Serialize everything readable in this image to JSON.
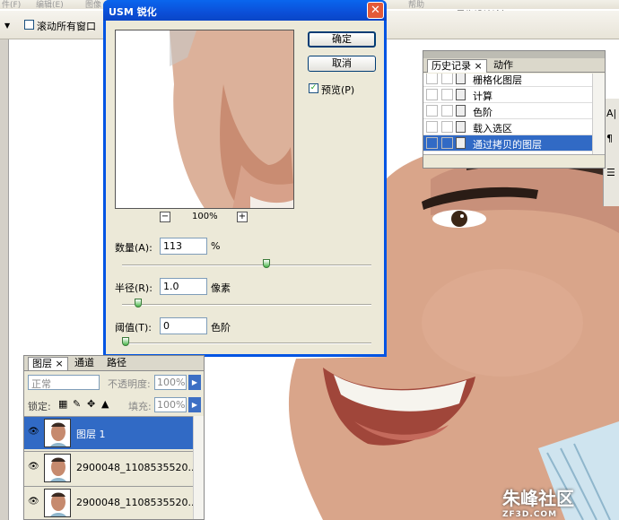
{
  "menubar": {
    "items": [
      "件(F)",
      "编辑(E)",
      "图像",
      "帮助"
    ]
  },
  "site_watermark": "思缘设计论坛 WWW.MISSYUAN.COM",
  "options": {
    "scroll_all_label": "滚动所有窗口"
  },
  "dialog": {
    "title": "USM 锐化",
    "close_glyph": "✕",
    "ok_label": "确定",
    "cancel_label": "取消",
    "preview_label": "预览(P)",
    "preview_checked": true,
    "zoom_out_glyph": "−",
    "zoom_in_glyph": "+",
    "zoom": "100%",
    "amount": {
      "label": "数量(A):",
      "value": "113",
      "unit": "%",
      "slider_level": 0.58
    },
    "radius": {
      "label": "半径(R):",
      "value": "1.0",
      "unit": "像素",
      "slider_level": 0.05
    },
    "threshold": {
      "label": "阈值(T):",
      "value": "0",
      "unit": "色阶",
      "slider_level": 0.0
    }
  },
  "history": {
    "tabs": [
      "历史记录 ×",
      "动作"
    ],
    "items": [
      {
        "label": "栅格化图层",
        "selected": false
      },
      {
        "label": "计算",
        "selected": false
      },
      {
        "label": "色阶",
        "selected": false
      },
      {
        "label": "载入选区",
        "selected": false
      },
      {
        "label": "通过拷贝的图层",
        "selected": true
      }
    ]
  },
  "layers": {
    "tabs": [
      "图层 ×",
      "通道",
      "路径"
    ],
    "blend_mode": "正常",
    "opacity_label": "不透明度:",
    "opacity": "100%",
    "lock_label": "锁定:",
    "fill_label": "填充:",
    "fill": "100%",
    "rows": [
      {
        "name": "图层 1",
        "selected": true
      },
      {
        "name": "2900048_1108535520...",
        "selected": false
      },
      {
        "name": "2900048_1108535520...",
        "selected": false
      }
    ]
  },
  "corner_watermark": {
    "main": "朱峰社区",
    "sub": "ZF3D.COM"
  },
  "right_tools": [
    "A|",
    "¶",
    "☰"
  ],
  "colors": {
    "dialog_title": "#0a56e0",
    "selection": "#316ac5",
    "slider_thumb": "#46b746"
  }
}
